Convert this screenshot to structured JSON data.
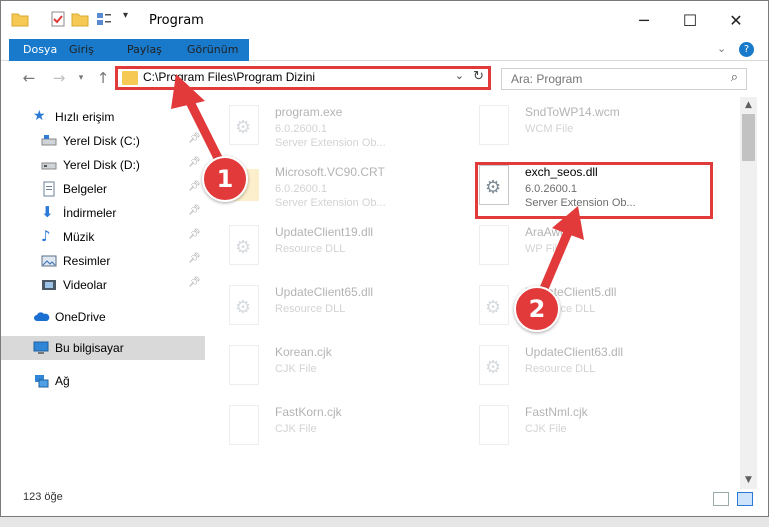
{
  "window": {
    "title": "Program",
    "minimize": "─",
    "maximize": "☐",
    "close": "✕"
  },
  "ribbon": {
    "tabs": [
      "Dosya",
      "Giriş",
      "Paylaş",
      "Görünüm"
    ]
  },
  "address": {
    "path": "C:\\Program Files\\Program Dizini"
  },
  "search": {
    "placeholder": "Ara: Program"
  },
  "sidebar": {
    "quick_access": "Hızlı erişim",
    "items": [
      {
        "label": "Yerel Disk (C:)"
      },
      {
        "label": "Yerel Disk (D:)"
      },
      {
        "label": "Belgeler"
      },
      {
        "label": "İndirmeler"
      },
      {
        "label": "Müzik"
      },
      {
        "label": "Resimler"
      },
      {
        "label": "Videolar"
      }
    ],
    "onedrive": "OneDrive",
    "this_pc": "Bu bilgisayar",
    "network": "Ağ"
  },
  "files": [
    {
      "name": "program.exe",
      "line2": "6.0.2600.1",
      "line3": "Server Extension Ob..."
    },
    {
      "name": "SndToWP14.wcm",
      "line2": "WCM File",
      "line3": ""
    },
    {
      "name": "Microsoft.VC90.CRT",
      "line2": "6.0.2600.1",
      "line3": "Server Extension Ob..."
    },
    {
      "name": "exch_seos.dll",
      "line2": "6.0.2600.1",
      "line3": "Server Extension Ob..."
    },
    {
      "name": "UpdateClient19.dll",
      "line2": "Resource DLL",
      "line3": ""
    },
    {
      "name": "AraAword",
      "line2": "WP File",
      "line3": ""
    },
    {
      "name": "UpdateClient65.dll",
      "line2": "Resource DLL",
      "line3": ""
    },
    {
      "name": "UpdateClient5.dll",
      "line2": "Resource DLL",
      "line3": ""
    },
    {
      "name": "Korean.cjk",
      "line2": "CJK File",
      "line3": ""
    },
    {
      "name": "UpdateClient63.dll",
      "line2": "Resource DLL",
      "line3": ""
    },
    {
      "name": "FastKorn.cjk",
      "line2": "CJK File",
      "line3": ""
    },
    {
      "name": "FastNml.cjk",
      "line2": "CJK File",
      "line3": ""
    }
  ],
  "status": {
    "count": "123 öğe"
  },
  "annotations": {
    "step1": "1",
    "step2": "2",
    "color": "#e23a3a"
  }
}
